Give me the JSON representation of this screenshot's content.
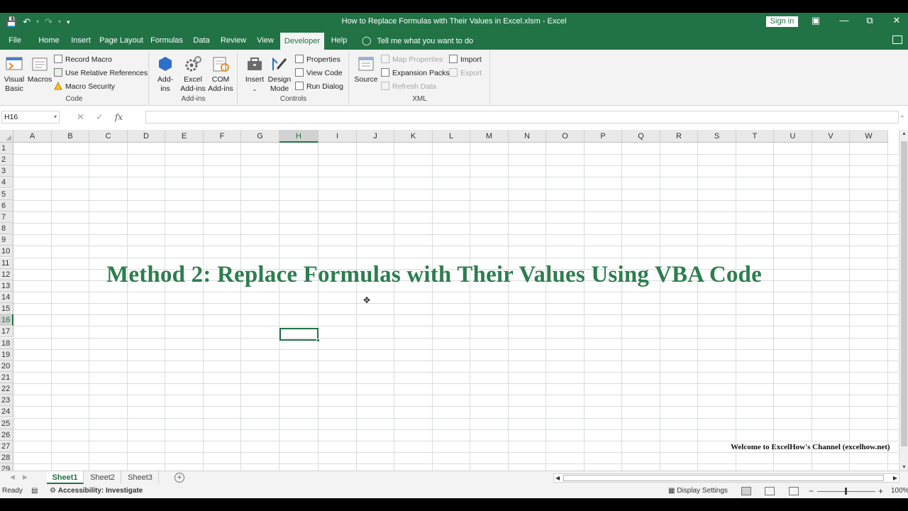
{
  "window": {
    "title": "How to Replace Formulas with Their Values in Excel.xlsm  -  Excel",
    "sign_in": "Sign in"
  },
  "qat": {
    "save_icon": "save-icon",
    "undo_icon": "undo-icon",
    "redo_icon": "redo-icon",
    "customize_icon": "customize-qat-icon"
  },
  "tabs": {
    "file": "File",
    "home": "Home",
    "insert": "Insert",
    "page_layout": "Page Layout",
    "formulas": "Formulas",
    "data": "Data",
    "review": "Review",
    "view": "View",
    "developer": "Developer",
    "help": "Help",
    "tell_me": "Tell me what you want to do"
  },
  "ribbon": {
    "code": {
      "label": "Code",
      "visual_basic_1": "Visual",
      "visual_basic_2": "Basic",
      "macros": "Macros",
      "record_macro": "Record Macro",
      "use_relative": "Use Relative References",
      "macro_security": "Macro Security"
    },
    "addins": {
      "label": "Add-ins",
      "addins_1": "Add-",
      "addins_2": "ins",
      "excel_addins_1": "Excel",
      "excel_addins_2": "Add-ins",
      "com_addins_1": "COM",
      "com_addins_2": "Add-ins"
    },
    "controls": {
      "label": "Controls",
      "insert": "Insert",
      "design_mode_1": "Design",
      "design_mode_2": "Mode",
      "properties": "Properties",
      "view_code": "View Code",
      "run_dialog": "Run Dialog"
    },
    "xml": {
      "label": "XML",
      "source": "Source",
      "map_properties": "Map Properties",
      "expansion_packs": "Expansion Packs",
      "refresh_data": "Refresh Data",
      "import": "Import",
      "export": "Export"
    }
  },
  "formula_bar": {
    "name_box": "H16",
    "cancel": "✕",
    "enter": "✓",
    "fx": "fx",
    "formula": ""
  },
  "grid": {
    "columns": [
      "A",
      "B",
      "C",
      "D",
      "E",
      "F",
      "G",
      "H",
      "I",
      "J",
      "K",
      "L",
      "M",
      "N",
      "O",
      "P",
      "Q",
      "R",
      "S",
      "T",
      "U",
      "V",
      "W"
    ],
    "rows": [
      "1",
      "2",
      "3",
      "4",
      "5",
      "6",
      "7",
      "8",
      "9",
      "10",
      "11",
      "12",
      "13",
      "14",
      "15",
      "16",
      "17",
      "18",
      "19",
      "20",
      "21",
      "22",
      "23",
      "24",
      "25",
      "26",
      "27",
      "28",
      "29"
    ],
    "selected_column": "H",
    "selected_row": "16",
    "heading_text": "Method 2: Replace Formulas with Their Values Using VBA Code",
    "welcome_text": "Welcome to ExcelHow's  Channel (excelhow.net)"
  },
  "sheets": [
    "Sheet1",
    "Sheet2",
    "Sheet3"
  ],
  "active_sheet": "Sheet1",
  "status": {
    "ready": "Ready",
    "accessibility": "Accessibility: Investigate",
    "display_settings": "Display Settings",
    "zoom": "100%",
    "zoom_minus": "−",
    "zoom_plus": "+"
  },
  "colors": {
    "accent": "#217346",
    "heading": "#2e7d4f"
  }
}
